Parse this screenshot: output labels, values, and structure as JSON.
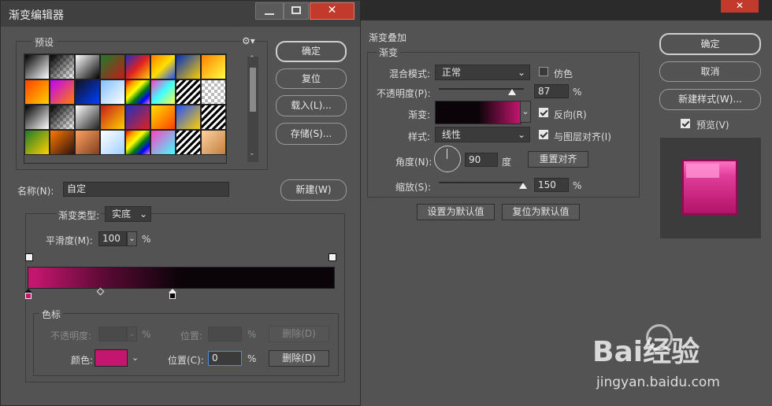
{
  "colors": {
    "magenta": "#c4166f",
    "dark": "#0a0308"
  },
  "dialog": {
    "title": "渐变编辑器",
    "presets_label": "预设",
    "buttons": {
      "ok": "确定",
      "reset": "复位",
      "load": "载入(L)...",
      "save": "存储(S)...",
      "new": "新建(W)"
    },
    "name_label": "名称(N):",
    "name_value": "自定",
    "type_label": "渐变类型:",
    "type_value": "实底",
    "smooth_label": "平滑度(M):",
    "smooth_value": "100",
    "percent": "%",
    "stops_title": "色标",
    "opacity_label": "不透明度:",
    "location_label_disabled": "位置:",
    "delete_label": "删除(D)",
    "color_label": "颜色:",
    "location_label": "位置(C):",
    "location_value": "0"
  },
  "layer_style": {
    "section_title": "渐变叠加",
    "group_title": "渐变",
    "blend_mode_label": "混合模式:",
    "blend_mode_value": "正常",
    "dither_label": "仿色",
    "opacity_label": "不透明度(P):",
    "opacity_value": "87",
    "gradient_label": "渐变:",
    "reverse_label": "反向(R)",
    "style_label": "样式:",
    "style_value": "线性",
    "align_label": "与图层对齐(I)",
    "angle_label": "角度(N):",
    "angle_value": "90",
    "degree_unit": "度",
    "reset_align_label": "重置对齐",
    "scale_label": "缩放(S):",
    "scale_value": "150",
    "percent": "%",
    "set_default_label": "设置为默认值",
    "reset_default_label": "复位为默认值"
  },
  "right_panel": {
    "ok_label": "确定",
    "cancel_label": "取消",
    "new_style_label": "新建样式(W)...",
    "preview_label": "预览(V)"
  },
  "watermark": {
    "brand": "Bai经验",
    "url": "jingyan.baidu.com"
  }
}
